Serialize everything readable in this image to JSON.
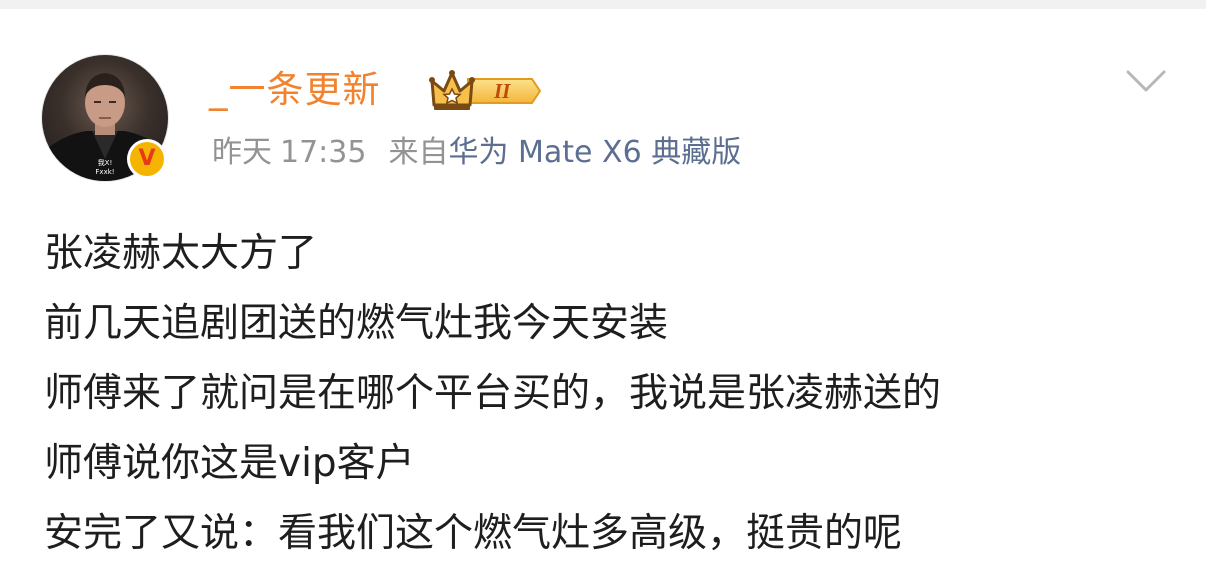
{
  "user": {
    "name": "_一条更新",
    "member_level": "II",
    "avatar_caption": "我X!\nFxxk!"
  },
  "meta": {
    "day": "昨天",
    "time": "17:35",
    "from_prefix": "来自",
    "device": "华为 Mate X6 典藏版"
  },
  "post": {
    "lines": [
      "张凌赫太大方了",
      "前几天追剧团送的燃气灶我今天安装",
      "师傅来了就问是在哪个平台买的，我说是张凌赫送的",
      "师傅说你这是vip客户",
      "安完了又说：看我们这个燃气灶多高级，挺贵的呢"
    ]
  },
  "icons": {
    "verified": "verified-v-icon",
    "member": "crown-member-icon",
    "menu": "chevron-down-icon"
  },
  "colors": {
    "username": "#f2822e",
    "meta_gray": "#939393",
    "device_link": "#5c6f91",
    "verified_bg": "#f5b400",
    "verified_v": "#e8381a",
    "text": "#1e1e1e"
  }
}
